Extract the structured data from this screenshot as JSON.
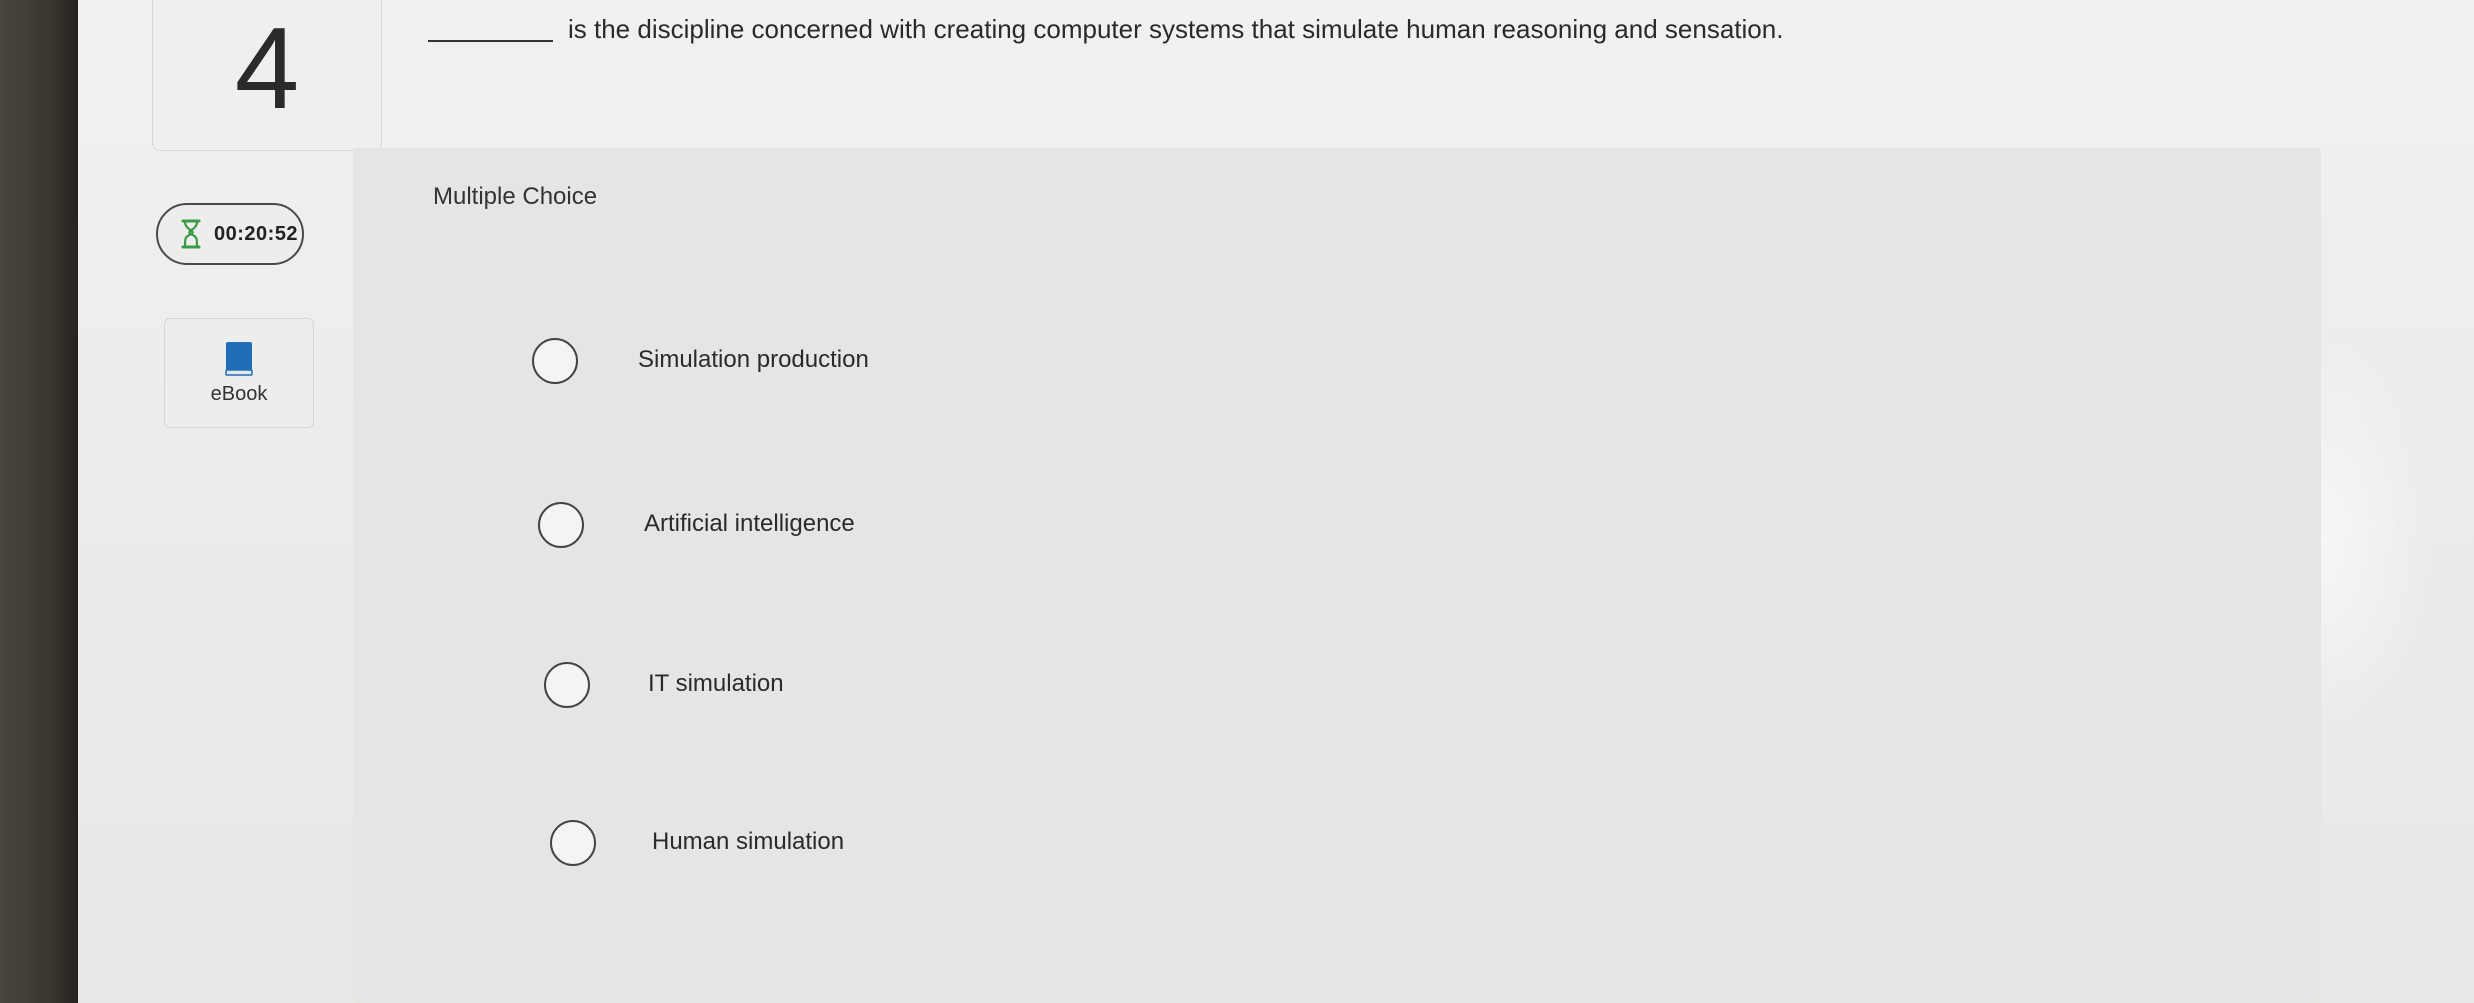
{
  "question": {
    "number": "4",
    "text": "is the discipline concerned with creating computer systems that simulate human reasoning and sensation."
  },
  "timer": {
    "icon": "hourglass-icon",
    "value": "00:20:52",
    "accent_color": "#3a9a48"
  },
  "ebook": {
    "icon": "book-icon",
    "label": "eBook",
    "icon_color": "#1e6fb8"
  },
  "answer_panel": {
    "type_label": "Multiple Choice",
    "options": [
      {
        "label": "Simulation production",
        "selected": false
      },
      {
        "label": "Artificial intelligence",
        "selected": false
      },
      {
        "label": "IT simulation",
        "selected": false
      },
      {
        "label": "Human simulation",
        "selected": false
      }
    ]
  }
}
